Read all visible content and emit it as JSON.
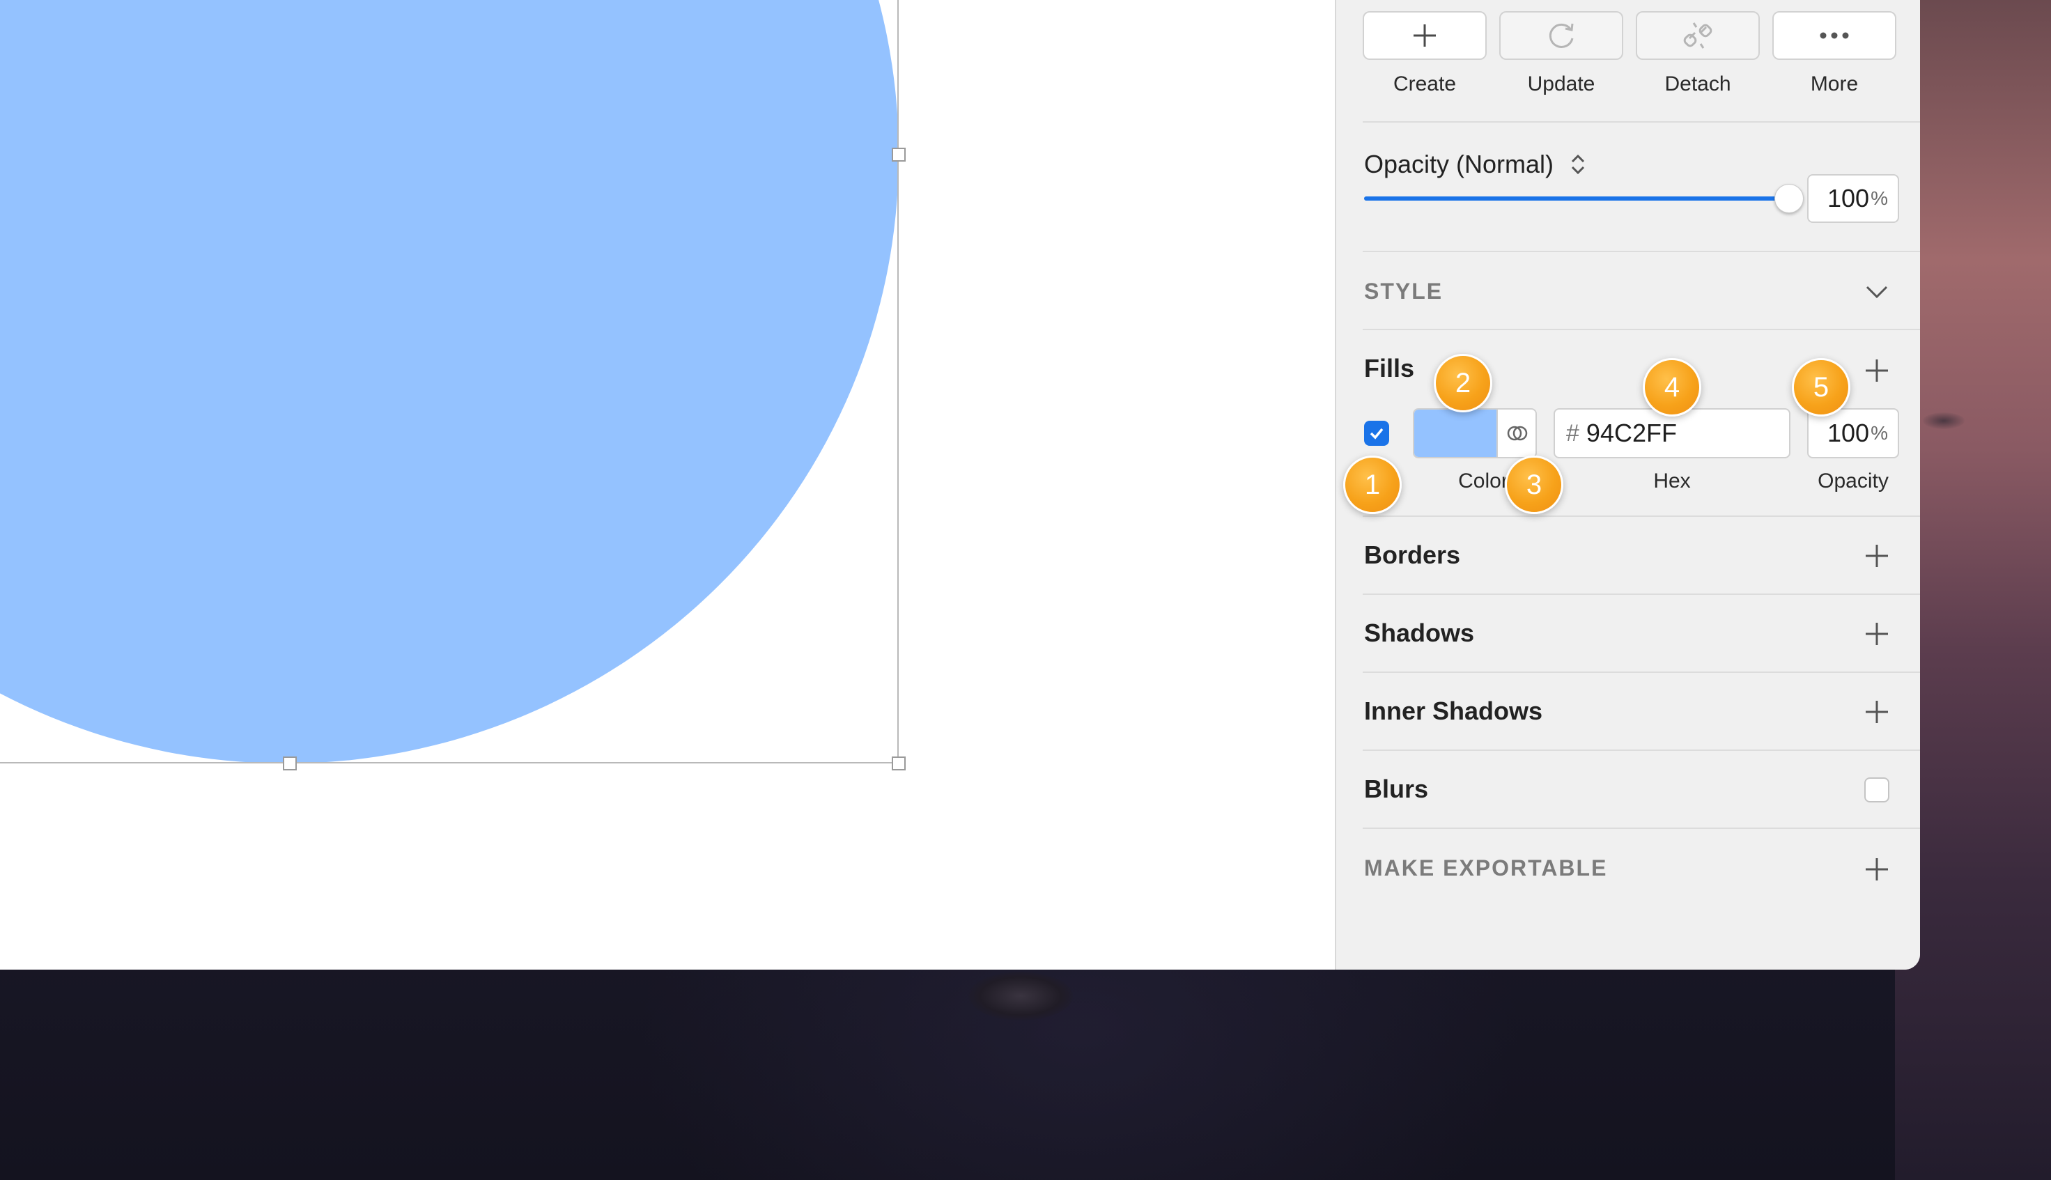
{
  "symbol_actions": {
    "create_label": "Create",
    "update_label": "Update",
    "detach_label": "Detach",
    "more_label": "More"
  },
  "opacity_section": {
    "label": "Opacity (Normal)",
    "value": "100",
    "unit": "%",
    "slider_fraction": 1.0
  },
  "style_section": {
    "title": "STYLE"
  },
  "fills": {
    "title": "Fills",
    "enabled": true,
    "color_hex": "#94C2FF",
    "hash_symbol": "#",
    "hex_value": "94C2FF",
    "opacity_value": "100",
    "opacity_unit": "%",
    "color_label": "Color",
    "hex_label": "Hex",
    "opacity_label": "Opacity"
  },
  "borders": {
    "title": "Borders"
  },
  "shadows": {
    "title": "Shadows"
  },
  "inner_shadows": {
    "title": "Inner Shadows"
  },
  "blurs": {
    "title": "Blurs"
  },
  "export": {
    "title": "MAKE EXPORTABLE"
  },
  "callouts": [
    "1",
    "2",
    "3",
    "4",
    "5"
  ],
  "colors": {
    "accent": "#1a73e8",
    "shape_fill": "#94C2FF",
    "callout": "#f7a21a"
  },
  "icons": {
    "create": "plus-icon",
    "update": "refresh-icon",
    "detach": "broken-link-icon",
    "more": "ellipsis-icon",
    "sort": "up-down-chevron-icon",
    "collapse": "chevron-down-icon",
    "color_variables": "color-variables-icon"
  }
}
